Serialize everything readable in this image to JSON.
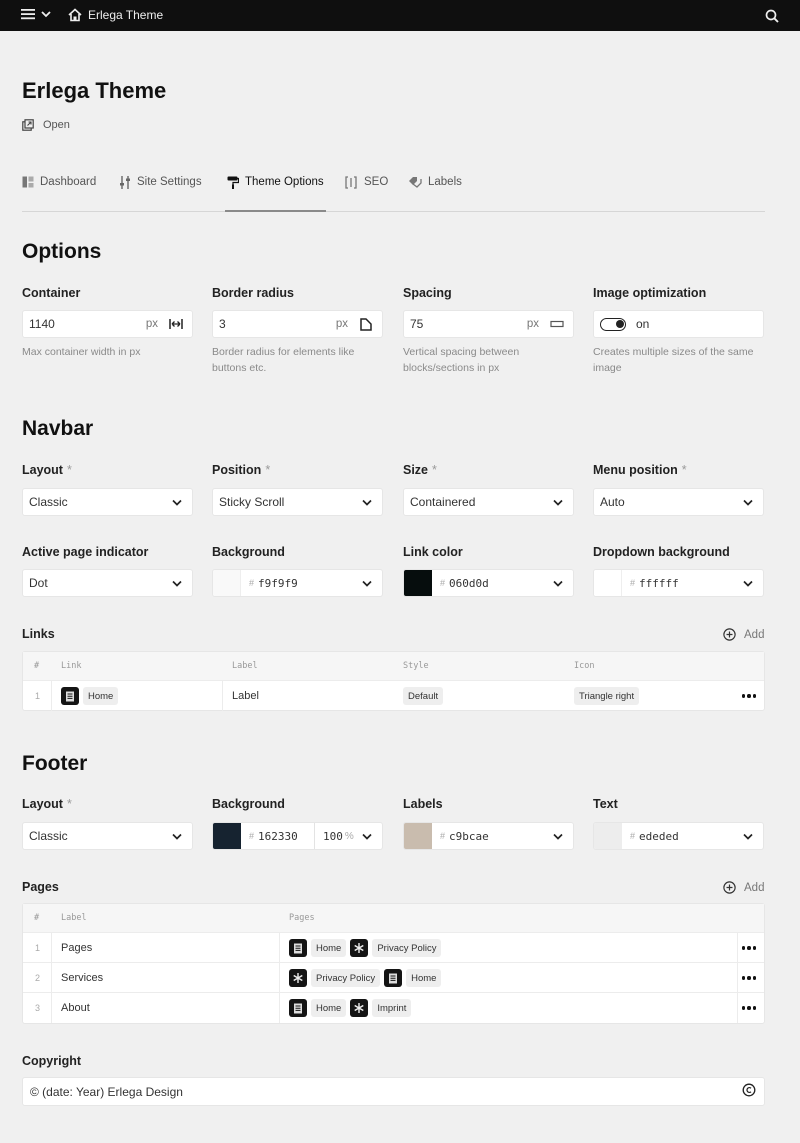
{
  "topbar": {
    "site_name": "Erlega Theme"
  },
  "header": {
    "title": "Erlega Theme",
    "open_label": "Open"
  },
  "tabs": [
    {
      "label": "Dashboard",
      "icon": "dashboard-icon"
    },
    {
      "label": "Site Settings",
      "icon": "sliders-icon"
    },
    {
      "label": "Theme Options",
      "icon": "paint-roller-icon",
      "active": true
    },
    {
      "label": "SEO",
      "icon": "seo-icon"
    },
    {
      "label": "Labels",
      "icon": "tags-icon"
    }
  ],
  "options": {
    "title": "Options",
    "container": {
      "label": "Container",
      "value": "1140",
      "unit": "px",
      "hint": "Max container width in px"
    },
    "border_radius": {
      "label": "Border radius",
      "value": "3",
      "unit": "px",
      "hint": "Border radius for elements like buttons etc."
    },
    "spacing": {
      "label": "Spacing",
      "value": "75",
      "unit": "px",
      "hint": "Vertical spacing between blocks/sections in px"
    },
    "image_optimization": {
      "label": "Image optimization",
      "value": "on",
      "hint": "Creates multiple sizes of the same image"
    }
  },
  "navbar": {
    "title": "Navbar",
    "layout": {
      "label": "Layout",
      "value": "Classic"
    },
    "position": {
      "label": "Position",
      "value": "Sticky Scroll"
    },
    "size": {
      "label": "Size",
      "value": "Containered"
    },
    "menu_position": {
      "label": "Menu position",
      "value": "Auto"
    },
    "active_indicator": {
      "label": "Active page indicator",
      "value": "Dot"
    },
    "background": {
      "label": "Background",
      "value": "f9f9f9",
      "color": "#f9f9f9"
    },
    "link_color": {
      "label": "Link color",
      "value": "060d0d",
      "color": "#060d0d"
    },
    "dropdown_bg": {
      "label": "Dropdown background",
      "value": "ffffff",
      "color": "#ffffff"
    },
    "links": {
      "label": "Links",
      "add_label": "Add",
      "headers": [
        "#",
        "Link",
        "Label",
        "Style",
        "Icon"
      ],
      "rows": [
        {
          "index": "1",
          "link": "Home",
          "label": "Label",
          "style": "Default",
          "icon": "Triangle right"
        }
      ]
    }
  },
  "footer": {
    "title": "Footer",
    "layout": {
      "label": "Layout",
      "value": "Classic"
    },
    "background": {
      "label": "Background",
      "value": "162330",
      "color": "#162330",
      "opacity": "100"
    },
    "labels": {
      "label": "Labels",
      "value": "c9bcae",
      "color": "#c9bcae"
    },
    "text": {
      "label": "Text",
      "value": "ededed",
      "color": "#ededed"
    },
    "pages": {
      "label": "Pages",
      "add_label": "Add",
      "headers": [
        "#",
        "Label",
        "Pages"
      ],
      "rows": [
        {
          "index": "1",
          "label": "Pages",
          "p1": "Home",
          "p2": "Privacy Policy"
        },
        {
          "index": "2",
          "label": "Services",
          "p1": "Privacy Policy",
          "p2": "Home"
        },
        {
          "index": "3",
          "label": "About",
          "p1": "Home",
          "p2": "Imprint"
        }
      ]
    },
    "copyright": {
      "label": "Copyright",
      "value": "© (date: Year) Erlega Design"
    }
  },
  "required_mark": "*",
  "hash_mark": "#",
  "percent_mark": "%"
}
